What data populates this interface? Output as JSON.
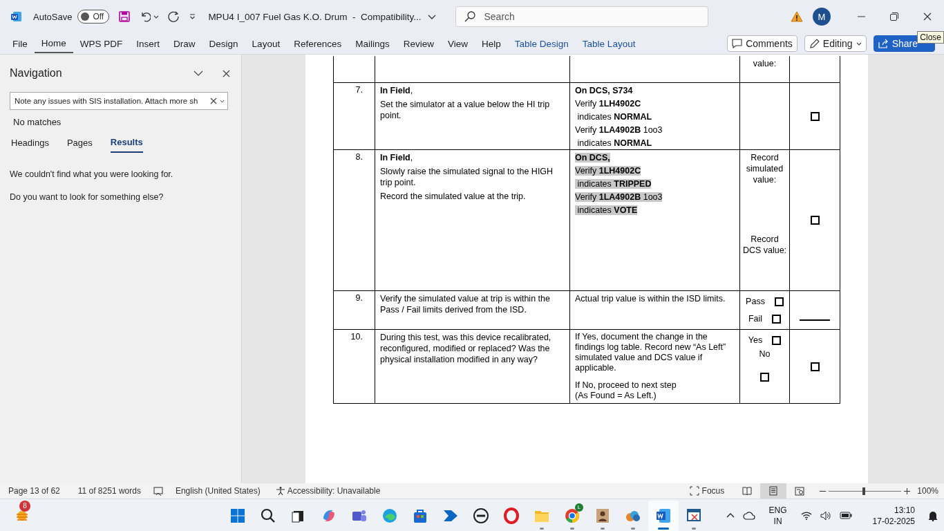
{
  "window": {
    "title": "MPU4 I_007 Fuel Gas K.O. Drum  -  Compatibility...",
    "autosave": {
      "label": "AutoSave",
      "state": "Off",
      "on": false
    },
    "search": {
      "placeholder": "Search"
    },
    "avatar": "M",
    "tooltip": "Close"
  },
  "ribbon": {
    "tabs": [
      {
        "label": "File",
        "selected": false,
        "kind": "normal"
      },
      {
        "label": "Home",
        "selected": true,
        "kind": "normal"
      },
      {
        "label": "WPS PDF",
        "selected": false,
        "kind": "normal"
      },
      {
        "label": "Insert",
        "selected": false,
        "kind": "normal"
      },
      {
        "label": "Draw",
        "selected": false,
        "kind": "normal"
      },
      {
        "label": "Design",
        "selected": false,
        "kind": "normal"
      },
      {
        "label": "Layout",
        "selected": false,
        "kind": "normal"
      },
      {
        "label": "References",
        "selected": false,
        "kind": "normal"
      },
      {
        "label": "Mailings",
        "selected": false,
        "kind": "normal"
      },
      {
        "label": "Review",
        "selected": false,
        "kind": "normal"
      },
      {
        "label": "View",
        "selected": false,
        "kind": "normal"
      },
      {
        "label": "Help",
        "selected": false,
        "kind": "normal"
      },
      {
        "label": "Table Design",
        "selected": false,
        "kind": "contextual"
      },
      {
        "label": "Table Layout",
        "selected": false,
        "kind": "contextual"
      }
    ],
    "buttons": [
      {
        "label": "Comments",
        "kind": "comments"
      },
      {
        "label": "Editing",
        "kind": "editing"
      },
      {
        "label": "Share",
        "kind": "share"
      }
    ]
  },
  "navigation": {
    "title": "Navigation",
    "search": {
      "value": "Note any issues with SIS installation. Attach more sh"
    },
    "status": "No matches",
    "tabs": [
      {
        "label": "Headings",
        "selected": false
      },
      {
        "label": "Pages",
        "selected": false
      },
      {
        "label": "Results",
        "selected": true
      }
    ],
    "messages": [
      "We couldn't find what you were looking for.",
      "Do you want to look for something else?"
    ]
  },
  "table": {
    "rows": [
      {
        "result": [
          {
            "kind": "text",
            "text": "value:"
          }
        ],
        "signoff": {
          "kind": "none"
        }
      },
      {
        "number": "7.",
        "step": [
          "**In Field**,",
          "Set the simulator at a value below the HI trip point."
        ],
        "verification": {
          "highlighted": false,
          "lines": [
            "**On DCS, S734**",
            "Verify **1LH4902C**",
            " indicates **NORMAL**",
            "Verify **1LA4902B** 1oo3",
            " indicates **NORMAL**"
          ]
        },
        "result": [],
        "signoff": {
          "kind": "checkbox",
          "checked": false
        }
      },
      {
        "number": "8.",
        "step": [
          "**In Field**,",
          "Slowly raise the simulated signal to the HIGH trip point.",
          "Record the simulated value at the trip."
        ],
        "verification": {
          "highlighted": true,
          "lines": [
            "**On DCS,**",
            "Verify **1LH4902C**",
            " indicates **TRIPPED**",
            "Verify **1LA4902B** 1oo3",
            " indicates **VOTE**"
          ]
        },
        "result": [
          {
            "kind": "text",
            "text": "Record simulated value:"
          },
          {
            "kind": "text",
            "text": "Record DCS value:"
          }
        ],
        "signoff": {
          "kind": "checkbox",
          "checked": false
        }
      },
      {
        "number": "9.",
        "step": [
          "Verify the simulated value at trip is within the Pass / Fail limits derived from the ISD."
        ],
        "verification": {
          "highlighted": false,
          "lines": [
            "Actual trip value is within the ISD limits."
          ]
        },
        "result": [
          {
            "kind": "option",
            "label": "Pass",
            "checked": false
          },
          {
            "kind": "option",
            "label": "Fail",
            "checked": false
          }
        ],
        "signoff": {
          "kind": "line"
        }
      },
      {
        "number": "10.",
        "step": [
          "During this test, was this device recalibrated, reconfigured, modified or replaced? Was the physical installation modified in any way?"
        ],
        "verification": {
          "highlighted": false,
          "lines": [
            "If Yes, document the change in the findings log table. Record new “As Left” simulated value and DCS value if applicable.",
            "If No, proceed to next step",
            "(As Found = As Left.)"
          ]
        },
        "result": [
          {
            "kind": "option",
            "label": "Yes",
            "checked": false
          },
          {
            "kind": "stacked",
            "label": "No",
            "checked": false
          }
        ],
        "signoff": {
          "kind": "checkbox",
          "checked": false
        }
      }
    ]
  },
  "status_bar": {
    "page": "Page 13 of 62",
    "words": "11 of 8251 words",
    "language": "English (United States)",
    "accessibility": "Accessibility: Unavailable",
    "focus": "Focus",
    "views": [
      {
        "kind": "read",
        "selected": false
      },
      {
        "kind": "print",
        "selected": true
      },
      {
        "kind": "web",
        "selected": false
      }
    ],
    "zoom": {
      "level": 0.48,
      "reading": "100%"
    }
  },
  "taskbar": {
    "weather_badge": "8",
    "apps": [
      {
        "kind": "start",
        "open": false,
        "selected": false
      },
      {
        "kind": "search",
        "open": false,
        "selected": false
      },
      {
        "kind": "taskview",
        "open": false,
        "selected": false
      },
      {
        "kind": "copilot",
        "open": false,
        "selected": false
      },
      {
        "kind": "teams",
        "open": false,
        "selected": false
      },
      {
        "kind": "edge",
        "open": false,
        "selected": false
      },
      {
        "kind": "store",
        "open": false,
        "selected": false
      },
      {
        "kind": "automate",
        "open": false,
        "selected": false
      },
      {
        "kind": "dell",
        "open": false,
        "selected": false
      },
      {
        "kind": "opera",
        "open": false,
        "selected": false
      },
      {
        "kind": "folder",
        "open": true,
        "selected": false
      },
      {
        "kind": "chrome",
        "open": true,
        "selected": false,
        "badge": "L"
      },
      {
        "kind": "figure",
        "open": true,
        "selected": false
      },
      {
        "kind": "cloud",
        "open": true,
        "selected": false
      },
      {
        "kind": "word",
        "open": true,
        "selected": true
      },
      {
        "kind": "snip",
        "open": true,
        "selected": false
      }
    ],
    "language": [
      "ENG",
      "IN"
    ],
    "time": "13:10",
    "date": "17-02-2025"
  }
}
